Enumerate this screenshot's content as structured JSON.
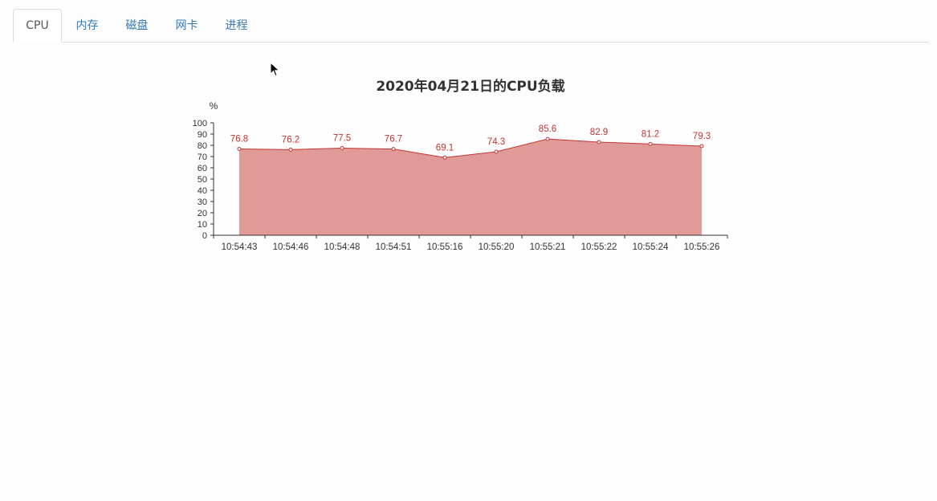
{
  "tabs": [
    {
      "label": "CPU",
      "active": true
    },
    {
      "label": "内存",
      "active": false
    },
    {
      "label": "磁盘",
      "active": false
    },
    {
      "label": "网卡",
      "active": false
    },
    {
      "label": "进程",
      "active": false
    }
  ],
  "chart_data": {
    "type": "area",
    "title": "2020年04月21日的CPU负载",
    "ylabel": "%",
    "xlabel": "",
    "categories": [
      "10:54:43",
      "10:54:46",
      "10:54:48",
      "10:54:51",
      "10:55:16",
      "10:55:20",
      "10:55:21",
      "10:55:22",
      "10:55:24",
      "10:55:26"
    ],
    "values": [
      76.8,
      76.2,
      77.5,
      76.7,
      69.1,
      74.3,
      85.6,
      82.9,
      81.2,
      79.3
    ],
    "ylim": [
      0,
      100
    ],
    "yticks": [
      0,
      10,
      20,
      30,
      40,
      50,
      60,
      70,
      80,
      90,
      100
    ],
    "grid": false,
    "colors": {
      "line": "#c23531",
      "fill": "#e09a98",
      "label": "#c23531",
      "axis": "#333333"
    }
  }
}
